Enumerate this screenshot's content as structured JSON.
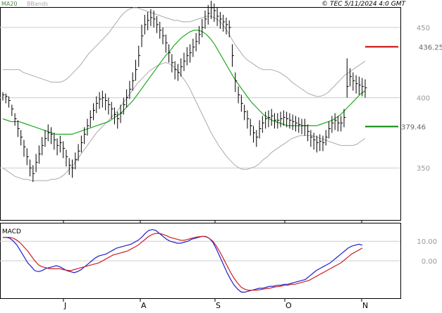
{
  "header": {
    "legend_ma": "MA20",
    "legend_bbands": "BBands",
    "copyright": "© TEC 5/11/2024 4:0 GMT"
  },
  "colors": {
    "price_bars": "#000000",
    "ma20": "#22aa22",
    "bbands": "#aaaaaa",
    "macd_line": "#1f1fcc",
    "signal_line": "#cc1f1f",
    "resistance": "#cc0000",
    "support": "#008800",
    "gridline": "#cccccc",
    "axis_text": "#999999"
  },
  "chart_data": [
    {
      "type": "ohlc",
      "name": "price",
      "title": "",
      "ylim": [
        313,
        464
      ],
      "yticks": [
        350,
        400,
        450
      ],
      "ytick_labels": [
        "350",
        "400",
        "450"
      ],
      "x_labels": [
        "J",
        "A",
        "S",
        "O",
        "N"
      ],
      "annotations": {
        "resistance": {
          "value": 436.25,
          "label": "436.25"
        },
        "support": {
          "value": 379.46,
          "label": "379.46"
        }
      },
      "close": [
        402,
        401,
        398,
        392,
        385,
        378,
        372,
        365,
        358,
        350,
        346,
        354,
        360,
        366,
        371,
        375,
        374,
        370,
        366,
        368,
        364,
        358,
        352,
        350,
        356,
        362,
        368,
        374,
        380,
        386,
        391,
        396,
        399,
        400,
        398,
        395,
        392,
        388,
        385,
        389,
        395,
        400,
        406,
        412,
        420,
        430,
        444,
        452,
        455,
        457,
        456,
        452,
        448,
        444,
        439,
        432,
        425,
        420,
        418,
        422,
        426,
        430,
        432,
        436,
        440,
        445,
        450,
        456,
        460,
        464,
        462,
        458,
        456,
        454,
        452,
        450,
        430,
        412,
        402,
        396,
        390,
        385,
        380,
        375,
        372,
        378,
        382,
        385,
        386,
        387,
        384,
        384,
        385,
        386,
        385,
        384,
        383,
        382,
        381,
        380,
        380,
        376,
        372,
        370,
        368,
        369,
        368,
        372,
        378,
        382,
        384,
        382,
        382,
        386,
        408,
        415,
        412,
        410,
        409,
        408,
        407
      ],
      "high": [
        404,
        403,
        401,
        395,
        389,
        384,
        377,
        370,
        364,
        356,
        352,
        360,
        366,
        372,
        377,
        381,
        379,
        375,
        371,
        373,
        369,
        363,
        357,
        356,
        361,
        367,
        373,
        379,
        385,
        391,
        396,
        401,
        404,
        405,
        403,
        400,
        397,
        393,
        390,
        395,
        400,
        406,
        412,
        418,
        427,
        437,
        452,
        459,
        461,
        463,
        462,
        458,
        454,
        450,
        445,
        438,
        431,
        426,
        424,
        428,
        432,
        436,
        438,
        442,
        446,
        451,
        456,
        462,
        466,
        469,
        467,
        464,
        461,
        459,
        457,
        455,
        438,
        418,
        408,
        402,
        395,
        391,
        385,
        380,
        377,
        384,
        387,
        390,
        391,
        392,
        389,
        389,
        390,
        391,
        390,
        389,
        388,
        387,
        386,
        385,
        385,
        381,
        377,
        375,
        373,
        374,
        373,
        377,
        383,
        387,
        389,
        387,
        387,
        392,
        428,
        421,
        418,
        416,
        415,
        414,
        413
      ],
      "low": [
        398,
        396,
        393,
        387,
        380,
        372,
        366,
        358,
        352,
        344,
        340,
        347,
        353,
        359,
        365,
        369,
        367,
        363,
        359,
        361,
        357,
        351,
        345,
        343,
        349,
        355,
        361,
        367,
        373,
        379,
        384,
        389,
        392,
        393,
        391,
        388,
        385,
        381,
        378,
        382,
        388,
        393,
        399,
        405,
        412,
        422,
        436,
        445,
        448,
        451,
        450,
        446,
        442,
        438,
        432,
        425,
        418,
        413,
        412,
        415,
        419,
        423,
        425,
        429,
        433,
        438,
        443,
        449,
        452,
        456,
        454,
        451,
        449,
        447,
        445,
        443,
        422,
        404,
        396,
        390,
        384,
        378,
        373,
        368,
        365,
        371,
        375,
        378,
        379,
        380,
        378,
        378,
        379,
        380,
        379,
        378,
        377,
        376,
        375,
        374,
        373,
        369,
        365,
        363,
        361,
        362,
        362,
        366,
        371,
        375,
        377,
        376,
        376,
        379,
        400,
        408,
        405,
        403,
        402,
        401,
        400
      ],
      "ma20": [
        385,
        384,
        383,
        383,
        383,
        382,
        381,
        380,
        379,
        378,
        377,
        376,
        375,
        374,
        374,
        374,
        374,
        374,
        375,
        376,
        377,
        378,
        379,
        380,
        381,
        382,
        383,
        385,
        387,
        389,
        392,
        395,
        398,
        402,
        406,
        410,
        414,
        418,
        422,
        426,
        430,
        433,
        437,
        440,
        443,
        445,
        447,
        448,
        448,
        447,
        445,
        442,
        438,
        433,
        428,
        423,
        418,
        413,
        409,
        405,
        401,
        397,
        394,
        391,
        388,
        386,
        384,
        383,
        382,
        381,
        380,
        380,
        380,
        380,
        380,
        380,
        380,
        380,
        381,
        382,
        383,
        384,
        386,
        388,
        391,
        394,
        397,
        400,
        403,
        405
      ],
      "bb_upper": [
        420,
        420,
        420,
        420,
        420,
        418,
        417,
        416,
        415,
        414,
        413,
        412,
        411,
        411,
        411,
        412,
        414,
        417,
        420,
        423,
        427,
        431,
        434,
        437,
        440,
        443,
        446,
        450,
        454,
        458,
        461,
        463,
        464,
        464,
        463,
        462,
        461,
        460,
        459,
        458,
        457,
        456,
        455,
        455,
        454,
        454,
        454,
        455,
        456,
        457,
        458,
        458,
        457,
        455,
        452,
        448,
        443,
        438,
        434,
        430,
        427,
        425,
        423,
        421,
        420,
        420,
        420,
        419,
        418,
        416,
        414,
        411,
        409,
        407,
        405,
        403,
        402,
        401,
        401,
        402,
        404,
        407,
        410,
        413,
        416,
        418,
        420,
        422,
        424,
        426
      ],
      "bb_lower": [
        350,
        348,
        346,
        344,
        343,
        342,
        342,
        341,
        341,
        341,
        341,
        341,
        342,
        342,
        343,
        345,
        348,
        351,
        355,
        359,
        363,
        367,
        371,
        375,
        378,
        381,
        384,
        387,
        390,
        394,
        398,
        402,
        406,
        410,
        413,
        416,
        419,
        421,
        423,
        424,
        425,
        424,
        422,
        419,
        415,
        411,
        406,
        400,
        394,
        388,
        382,
        376,
        371,
        366,
        362,
        358,
        355,
        352,
        350,
        349,
        349,
        350,
        351,
        353,
        356,
        358,
        361,
        363,
        365,
        367,
        369,
        371,
        372,
        373,
        373,
        373,
        373,
        372,
        371,
        370,
        369,
        368,
        367,
        366,
        366,
        366,
        366,
        367,
        369,
        371
      ]
    },
    {
      "type": "line",
      "name": "MACD",
      "title": "MACD",
      "ylim": [
        -18,
        18
      ],
      "yticks": [
        10,
        0
      ],
      "ytick_labels": [
        "10.00",
        "0.00"
      ],
      "series": [
        {
          "values": [
            12,
            12,
            11.5,
            10,
            8,
            5,
            2,
            -1,
            -3,
            -5,
            -5.5,
            -5,
            -4,
            -3.5,
            -3,
            -2.5,
            -3,
            -4,
            -5,
            -5.5,
            -6,
            -5.5,
            -4.5,
            -3,
            -1.5,
            0,
            1.5,
            2.5,
            3,
            3.5,
            4.5,
            5.5,
            6.5,
            7,
            7.5,
            8,
            8.5,
            9.5,
            10.5,
            12,
            14,
            15.5,
            16,
            15.5,
            14,
            12.5,
            11,
            10,
            9.5,
            9,
            9,
            9.5,
            10,
            11,
            11.5,
            12,
            12.5,
            12.5,
            11.5,
            9.5,
            6,
            2,
            -2,
            -6,
            -9.5,
            -12.5,
            -14.5,
            -16,
            -16,
            -15.5,
            -15,
            -14.5,
            -14,
            -14,
            -13.5,
            -13,
            -13,
            -12.5,
            -12.5,
            -12,
            -12,
            -11.5,
            -11,
            -10.5,
            -10,
            -9.5,
            -8,
            -6.5,
            -5,
            -4,
            -3,
            -2,
            -1,
            0.5,
            2,
            3.5,
            5,
            6.5,
            7.5,
            8,
            8.5,
            8
          ]
        },
        {
          "values": [
            12,
            12,
            12,
            11.5,
            10.5,
            9,
            7,
            5,
            2.5,
            0,
            -2,
            -3,
            -3.5,
            -4,
            -4,
            -4,
            -4,
            -4.5,
            -4.8,
            -5,
            -4.5,
            -4,
            -3.5,
            -3,
            -2.5,
            -2,
            -1.5,
            -1,
            0,
            1,
            2,
            3,
            3.5,
            4,
            4.5,
            5,
            6,
            7,
            8,
            9.5,
            11,
            12.5,
            13.5,
            14,
            14,
            13.5,
            12.8,
            12,
            11.5,
            11,
            10.5,
            10.5,
            11,
            11.5,
            12,
            12.3,
            12.5,
            12.3,
            11.5,
            10,
            7.5,
            4.5,
            1,
            -2.5,
            -6,
            -9,
            -11.5,
            -13.5,
            -14.5,
            -15,
            -15,
            -15,
            -14.8,
            -14.5,
            -14.2,
            -14,
            -13.5,
            -13.2,
            -13,
            -12.5,
            -12.5,
            -12,
            -12,
            -11.5,
            -11,
            -10.5,
            -10,
            -9,
            -8,
            -7,
            -6,
            -5,
            -4,
            -3,
            -2,
            -1,
            0.5,
            2,
            3.5,
            4.5,
            5.5,
            6.5
          ]
        }
      ]
    }
  ]
}
